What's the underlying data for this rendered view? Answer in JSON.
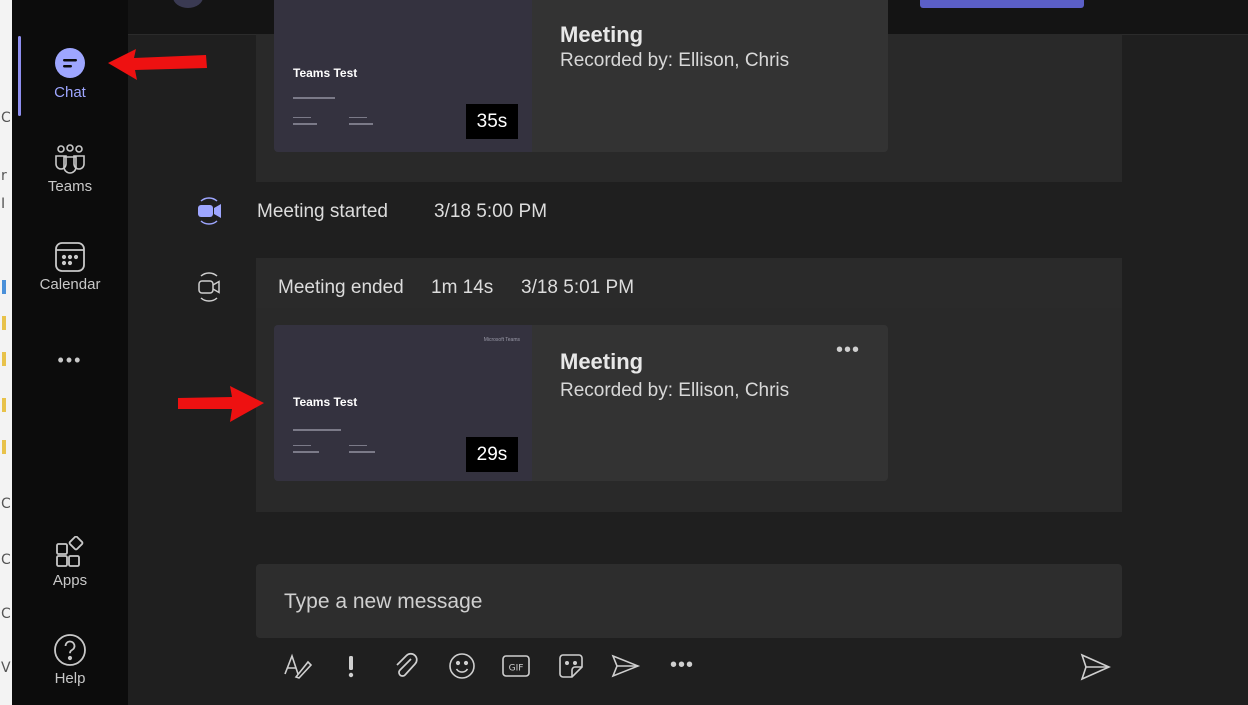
{
  "app_bar": {
    "items": [
      {
        "label": "Chat",
        "icon": "chat-icon"
      },
      {
        "label": "Teams",
        "icon": "teams-icon"
      },
      {
        "label": "Calendar",
        "icon": "calendar-icon"
      },
      {
        "label": "Apps",
        "icon": "apps-icon"
      },
      {
        "label": "Help",
        "icon": "help-icon"
      }
    ],
    "more_label": "•••"
  },
  "left_strip": [
    "C",
    "r",
    "I",
    "C",
    "C",
    "C",
    "V"
  ],
  "messages": [
    {
      "card": {
        "thumb_title": "Teams Test",
        "duration": "35s",
        "title": "Meeting",
        "subtitle": "Recorded by: Ellison, Chris"
      }
    },
    {
      "event": {
        "text": "Meeting started",
        "time": "3/18 5:00 PM",
        "icon": "meeting-started-icon"
      }
    },
    {
      "header": {
        "text": "Meeting ended",
        "duration": "1m 14s",
        "time": "3/18 5:01 PM",
        "icon": "meeting-ended-icon"
      },
      "card": {
        "thumb_title": "Teams Test",
        "thumb_brand": "Microsoft Teams",
        "duration": "29s",
        "title": "Meeting",
        "subtitle": "Recorded by: Ellison, Chris",
        "more": "•••"
      }
    }
  ],
  "compose": {
    "placeholder": "Type a new message",
    "tools": [
      "format-icon",
      "important-icon",
      "attach-icon",
      "emoji-icon",
      "gif-icon",
      "sticker-icon",
      "schedule-meeting-icon",
      "more-options-icon"
    ],
    "more": "•••",
    "send_icon": "send-icon"
  },
  "colors": {
    "accent": "#9ea6ff",
    "annotation_arrow": "#ee1111",
    "background": "#1f1f1f"
  }
}
